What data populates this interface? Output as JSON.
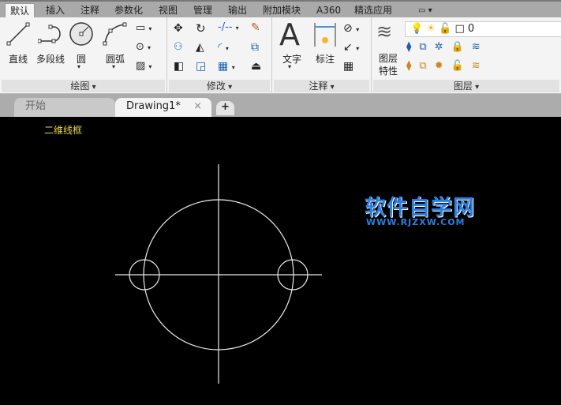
{
  "ribbon_tabs": [
    "默认",
    "插入",
    "注释",
    "参数化",
    "视图",
    "管理",
    "输出",
    "附加模块",
    "A360",
    "精选应用"
  ],
  "panels": {
    "draw": {
      "title": "绘图",
      "line": "直线",
      "polyline": "多段线",
      "circle": "圆",
      "arc": "圆弧"
    },
    "modify": {
      "title": "修改"
    },
    "annotation": {
      "title": "注释",
      "text": "文字",
      "dimension": "标注"
    },
    "layers": {
      "title": "图层",
      "properties_line1": "图层",
      "properties_line2": "特性",
      "current_layer": "0"
    }
  },
  "doc_tabs": {
    "start": "开始",
    "drawing": "Drawing1*",
    "close": "×",
    "new": "+"
  },
  "canvas": {
    "view_label": "二维线框"
  },
  "watermark": {
    "title": "软件自学网",
    "url": "WWW.RJZXW.COM"
  }
}
